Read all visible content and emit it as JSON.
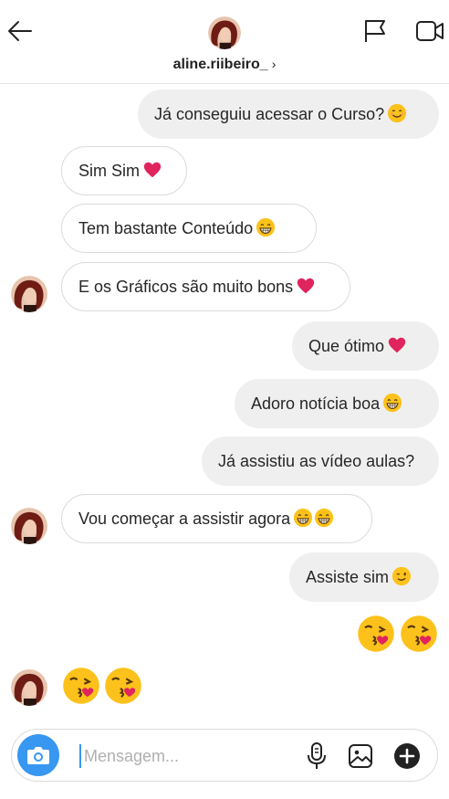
{
  "header": {
    "username": "aline.riibeiro_",
    "chevron": "›"
  },
  "messages": [
    {
      "side": "out",
      "text": "Já conseguiu acessar o Curso?",
      "emoji": "smiling-face-icon"
    },
    {
      "side": "in",
      "text": "Sim Sim",
      "emoji": "red-heart-icon"
    },
    {
      "side": "in",
      "text": "Tem bastante Conteúdo",
      "emoji": "grinning-face-icon"
    },
    {
      "side": "in",
      "text": "E os Gráficos são muito bons",
      "emoji": "red-heart-icon"
    },
    {
      "side": "out",
      "text": "Que ótimo",
      "emoji": "red-heart-icon"
    },
    {
      "side": "out",
      "text": "Adoro notícia boa",
      "emoji": "grinning-face-icon"
    },
    {
      "side": "out",
      "text": "Já assistiu as vídeo aulas?",
      "emoji": ""
    },
    {
      "side": "in",
      "text": "Vou começar a assistir agora",
      "emoji": "grinning-face-icon x2"
    },
    {
      "side": "out",
      "text": "Assiste sim",
      "emoji": "winking-face-icon"
    },
    {
      "side": "out",
      "text": "",
      "emoji": "face-blowing-kiss-icon x2"
    },
    {
      "side": "in",
      "text": "",
      "emoji": "face-blowing-kiss-icon x2"
    }
  ],
  "composer": {
    "placeholder": "Mensagem..."
  },
  "colors": {
    "accent": "#3897f0",
    "heart": "#e0245e",
    "outgoing_bubble": "#efefef",
    "incoming_border": "#dbdbdb"
  }
}
